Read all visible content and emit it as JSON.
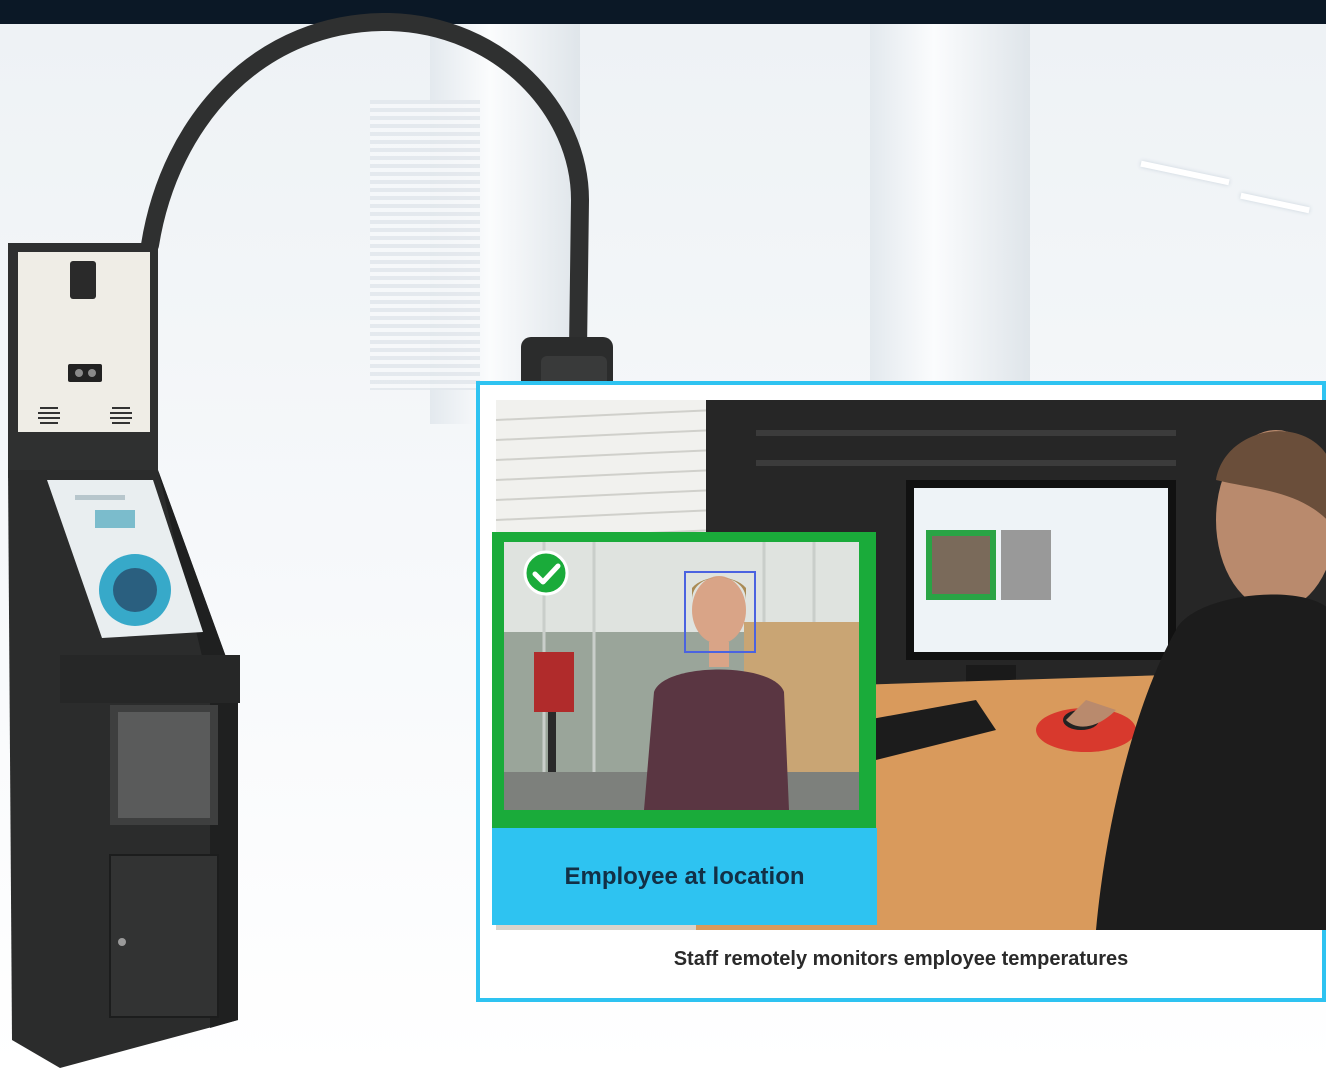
{
  "inset": {
    "label": "Employee at location"
  },
  "panel": {
    "caption": "Staff remotely monitors employee temperatures"
  },
  "colors": {
    "accent": "#2ec3f1",
    "verified_green": "#1aab3a",
    "top_bar": "#0b1826",
    "kiosk_body": "#2b2c2c"
  },
  "icons": [
    "check-icon",
    "face-detection-box",
    "speaker-grille-icon",
    "camera-icon"
  ]
}
